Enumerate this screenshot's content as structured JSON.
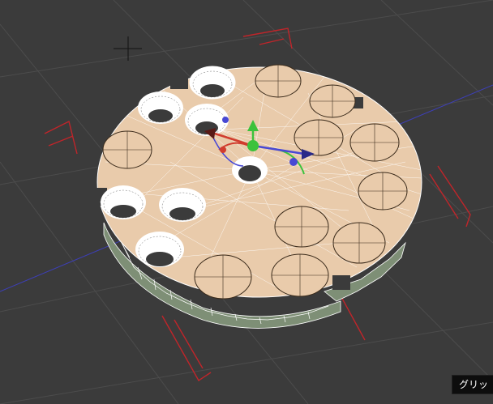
{
  "viewport": {
    "background": "#3b3b3b",
    "grid_color": "#4c4c4c",
    "bracket_color": "#c0252a",
    "axis_blue_color": "#3d3fb8",
    "model_top_color": "#e9cbab",
    "model_side_color": "#7e8f76",
    "wire_color": "#ffffff",
    "gizmo_y_color": "#3cc23c",
    "gizmo_x_color": "#d13c2e",
    "gizmo_z_color": "#4848d4"
  },
  "status_badge": {
    "label": "グリッ"
  }
}
